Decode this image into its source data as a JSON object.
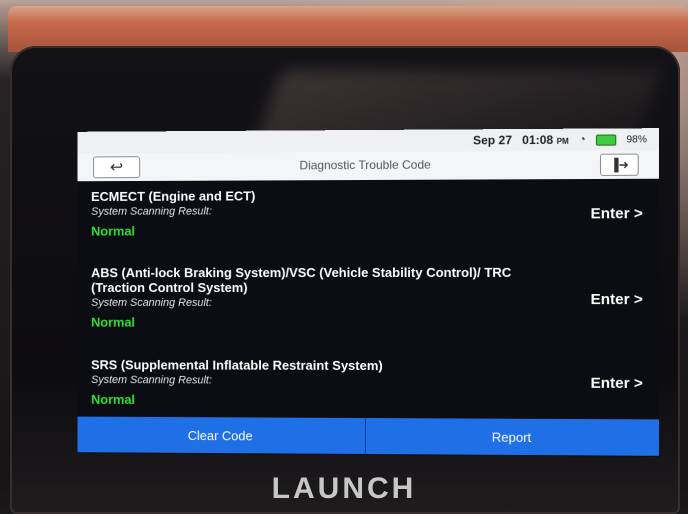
{
  "statusbar": {
    "date": "Sep 27",
    "time": "01:08",
    "ampm": "PM",
    "battery": "98%"
  },
  "header": {
    "title": "Diagnostic Trouble Code"
  },
  "systems": [
    {
      "title": "ECMECT (Engine and ECT)",
      "label": "System Scanning Result:",
      "result": "Normal",
      "enter": "Enter >"
    },
    {
      "title": "ABS (Anti-lock Braking System)/VSC (Vehicle Stability Control)/ TRC (Traction Control System)",
      "label": "System Scanning Result:",
      "result": "Normal",
      "enter": "Enter >"
    },
    {
      "title": "SRS (Supplemental Inflatable Restraint System)",
      "label": "System Scanning Result:",
      "result": "Normal",
      "enter": "Enter >"
    }
  ],
  "footer": {
    "clear": "Clear Code",
    "report": "Report"
  },
  "device": {
    "brand": "LAUNCH"
  },
  "colors": {
    "accent_blue": "#1f6fe6",
    "normal_green": "#33e033"
  }
}
